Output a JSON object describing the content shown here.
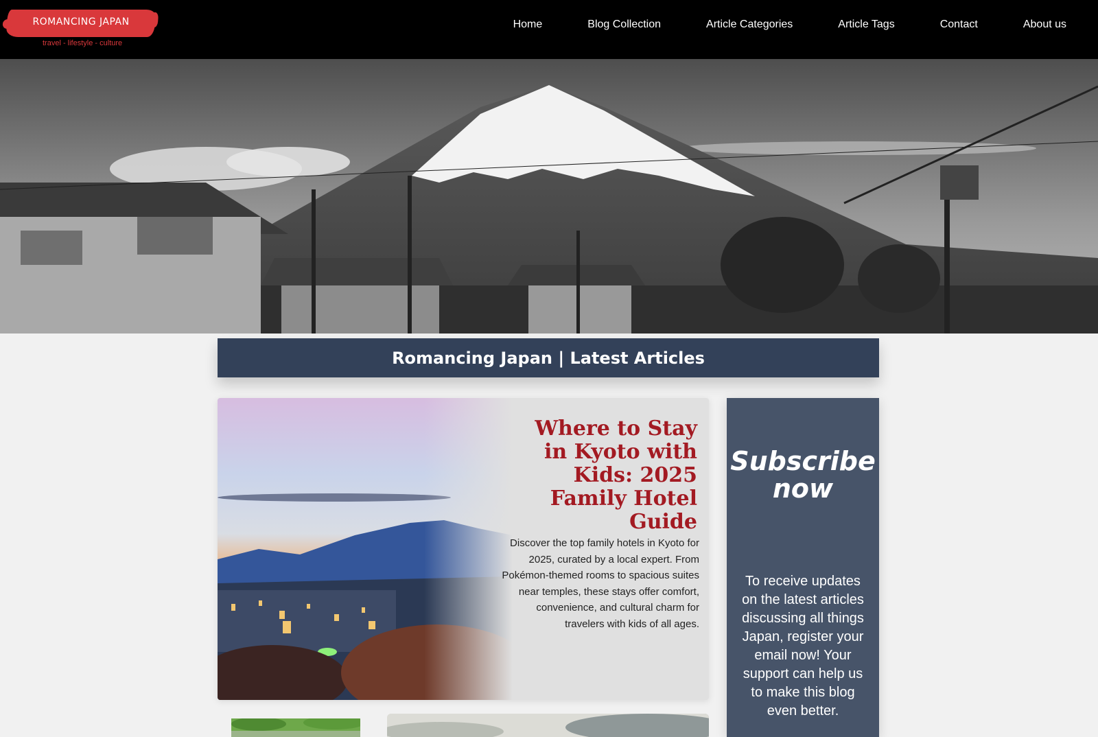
{
  "brand": {
    "logo_text": "ROMANCING JAPAN",
    "tagline": "travel - lifestyle - culture",
    "accent_color": "#d9383b"
  },
  "nav": {
    "items": [
      {
        "label": "Home"
      },
      {
        "label": "Blog Collection"
      },
      {
        "label": "Article Categories"
      },
      {
        "label": "Article Tags"
      },
      {
        "label": "Contact"
      },
      {
        "label": "About us"
      }
    ]
  },
  "hero": {
    "image_icon": "mount-fuji-photo"
  },
  "section": {
    "title": "Romancing Japan | Latest Articles",
    "background_color": "#334159"
  },
  "featured_article": {
    "title": "Where to Stay in Kyoto with Kids: 2025 Family Hotel Guide",
    "excerpt": "Discover the top family hotels in Kyoto for 2025, curated by a local expert. From Pokémon-themed rooms to spacious suites near temples, these stays offer comfort, convenience, and cultural charm for travelers with kids of all ages.",
    "title_color": "#a31a22",
    "image_icon": "kyoto-city-dusk-photo"
  },
  "subscribe": {
    "heading": "Subscribe now",
    "text": "To receive updates on the latest articles discussing all things Japan, register your email now! Your support can help us to make this blog even better.",
    "background_color": "#475469"
  }
}
